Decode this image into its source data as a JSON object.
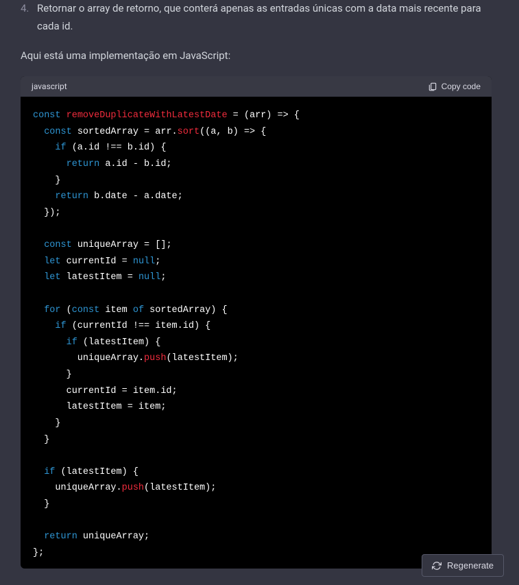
{
  "list": {
    "num": "4.",
    "text": "Retornar o array de retorno, que conterá apenas as entradas únicas com a data mais recente para cada id."
  },
  "intro": "Aqui está uma implementação em JavaScript:",
  "codeHeader": {
    "lang": "javascript",
    "copy": "Copy code"
  },
  "code": {
    "l1_kw1": "const",
    "l1_def": "removeDuplicateWithLatestDate",
    "l1_rest": " = (arr) => {",
    "l2_kw1": "const",
    "l2_mid": " sortedArray = arr.",
    "l2_fn": "sort",
    "l2_rest": "((a, b) => {",
    "l3_kw": "if",
    "l3_rest": " (a.id !== b.id) {",
    "l4_kw": "return",
    "l4_rest": " a.id - b.id;",
    "l5": "    }",
    "l6_kw": "return",
    "l6_rest": " b.date - a.date;",
    "l7": "  });",
    "l8": "",
    "l9_kw": "const",
    "l9_rest": " uniqueArray = [];",
    "l10_kw": "let",
    "l10_mid": " currentId = ",
    "l10_null": "null",
    "l10_end": ";",
    "l11_kw": "let",
    "l11_mid": " latestItem = ",
    "l11_null": "null",
    "l11_end": ";",
    "l12": "",
    "l13_kw1": "for",
    "l13_mid1": " (",
    "l13_kw2": "const",
    "l13_mid2": " item ",
    "l13_kw3": "of",
    "l13_rest": " sortedArray) {",
    "l14_kw": "if",
    "l14_rest": " (currentId !== item.id) {",
    "l15_kw": "if",
    "l15_rest": " (latestItem) {",
    "l16_mid": "        uniqueArray.",
    "l16_fn": "push",
    "l16_rest": "(latestItem);",
    "l17": "      }",
    "l18": "      currentId = item.id;",
    "l19": "      latestItem = item;",
    "l20": "    }",
    "l21": "  }",
    "l22": "",
    "l23_kw": "if",
    "l23_rest": " (latestItem) {",
    "l24_mid": "    uniqueArray.",
    "l24_fn": "push",
    "l24_rest": "(latestItem);",
    "l25": "  }",
    "l26": "",
    "l27_kw": "return",
    "l27_rest": " uniqueArray;",
    "l28": "};"
  },
  "regen": "Regenerate"
}
